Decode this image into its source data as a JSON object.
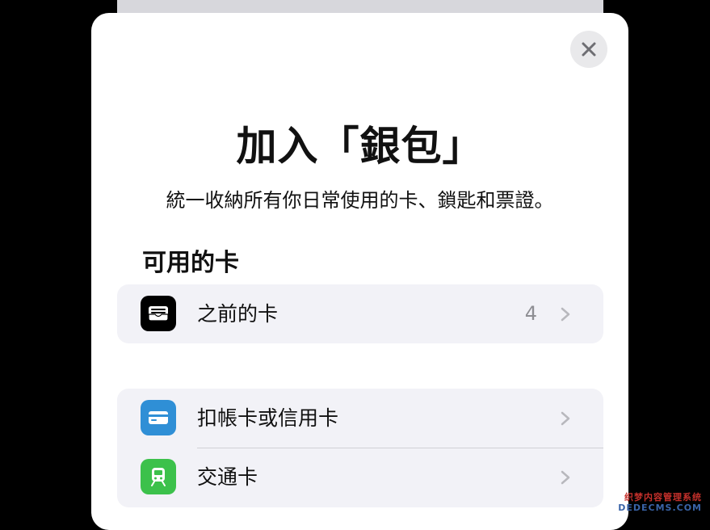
{
  "sheet": {
    "close_icon": "close-icon",
    "title": "加入「銀包」",
    "subtitle": "統一收納所有你日常使用的卡、鎖匙和票證。"
  },
  "available_cards": {
    "section_title": "可用的卡",
    "previous": {
      "label": "之前的卡",
      "count": "4",
      "icon": "wallet-icon"
    }
  },
  "add_cards": [
    {
      "label": "扣帳卡或信用卡",
      "icon": "credit-card-icon",
      "icon_color": "#2f8fd6"
    },
    {
      "label": "交通卡",
      "icon": "train-icon",
      "icon_color": "#3cc14b"
    }
  ],
  "watermark": {
    "line1": "织梦内容管理系统",
    "line2": "DEDECMS.COM"
  }
}
